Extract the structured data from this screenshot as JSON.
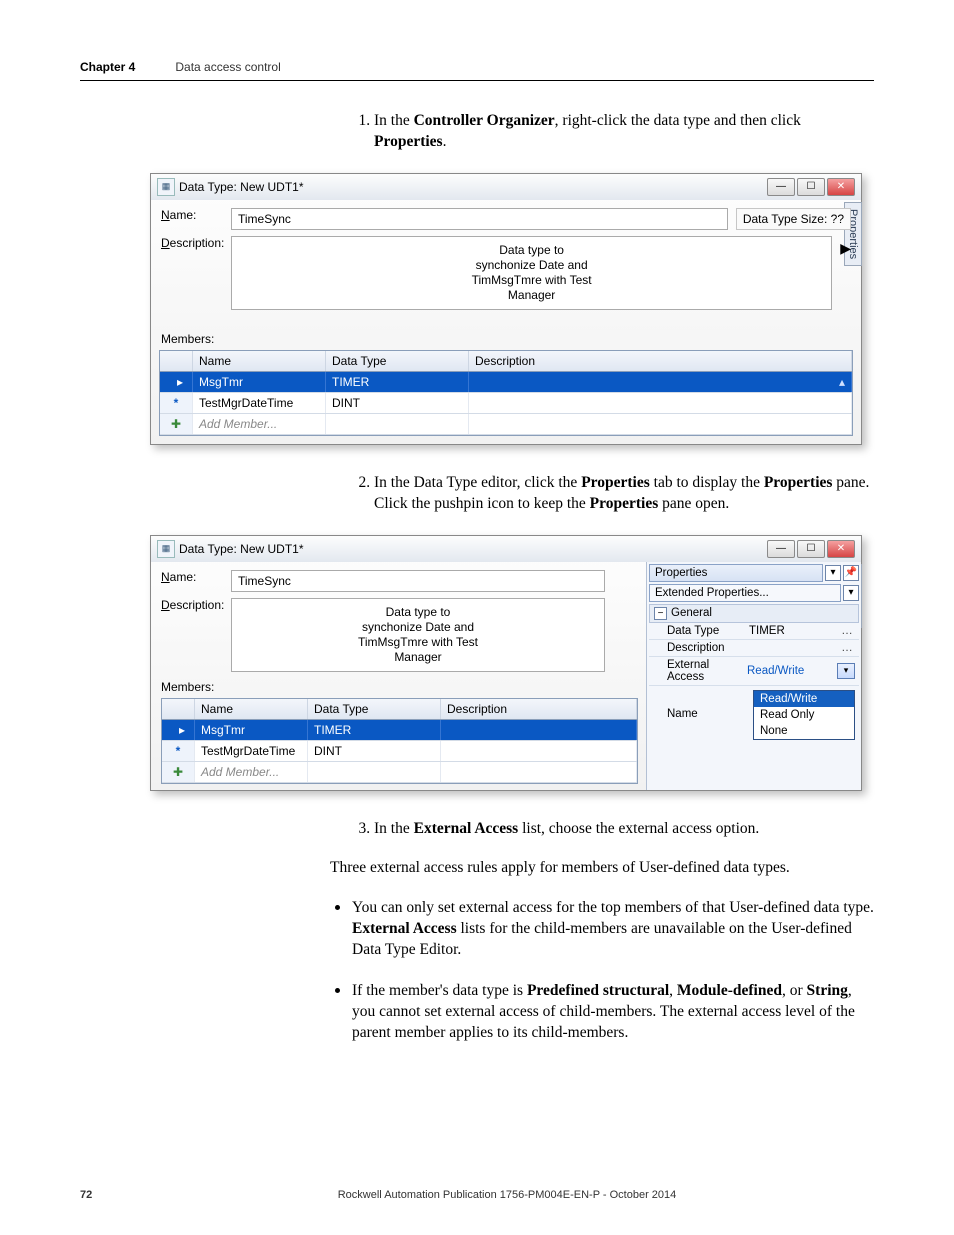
{
  "header": {
    "chapter": "Chapter 4",
    "section": "Data access control"
  },
  "steps": {
    "s1_a": "In the ",
    "s1_b": "Controller Organizer",
    "s1_c": ", right-click the data type and then click ",
    "s1_d": "Properties",
    "s1_e": ".",
    "s2_a": "In the Data Type editor, click the ",
    "s2_b": "Properties",
    "s2_c": " tab to display the ",
    "s2_d": "Properties",
    "s2_e": " pane. Click the pushpin icon to keep the ",
    "s2_f": "Properties",
    "s2_g": " pane open.",
    "s3_a": "In the ",
    "s3_b": "External Access",
    "s3_c": " list, choose the external access option."
  },
  "para": {
    "intro": "Three external access rules apply for members of User-defined data types.",
    "b1_a": "You can only set external access for the top members of that User-defined data type. ",
    "b1_b": "External Access",
    "b1_c": " lists for the child-members are unavailable on the User-defined Data Type Editor.",
    "b2_a": "If the member's data type is ",
    "b2_b": "Predefined structural",
    "b2_c": ", ",
    "b2_d": "Module-defined",
    "b2_e": ", or ",
    "b2_f": "String",
    "b2_g": ", you cannot set external access of child-members. The external access level of the parent member applies to its child-members."
  },
  "win": {
    "title": "Data Type: New UDT1*",
    "name_label_u": "N",
    "name_label_rest": "ame:",
    "name_value": "TimeSync",
    "size_label": "Data Type Size: ??",
    "desc_label_u": "D",
    "desc_label_rest": "escription:",
    "desc_value": "Data type to\nsynchonize Date and\nTimMsgTmre with Test\nManager",
    "members_label": "Members:",
    "col_name": "Name",
    "col_type": "Data Type",
    "col_desc": "Description",
    "row1_name": "MsgTmr",
    "row1_type": "TIMER",
    "row2_name": "TestMgrDateTime",
    "row2_type": "DINT",
    "add_member": "Add Member...",
    "side_tab": "Properties"
  },
  "props": {
    "tab1": "Properties",
    "tab2": "Extended Properties...",
    "general": "General",
    "k_type": "Data Type",
    "v_type": "TIMER",
    "k_desc": "Description",
    "k_ext": "External Access",
    "v_ext": "Read/Write",
    "k_name": "Name",
    "opt1": "Read/Write",
    "opt2": "Read Only",
    "opt3": "None"
  },
  "footer": {
    "page": "72",
    "pub": "Rockwell Automation Publication 1756-PM004E-EN-P - October 2014"
  }
}
